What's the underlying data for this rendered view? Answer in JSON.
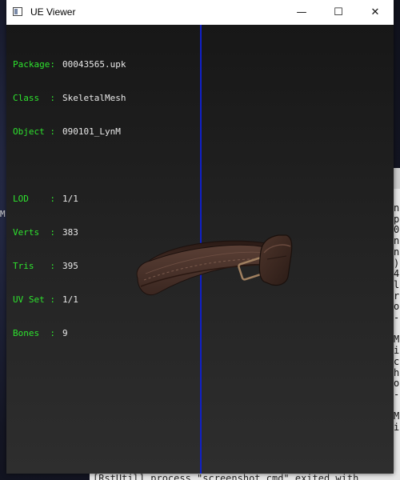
{
  "window": {
    "title": "UE Viewer",
    "minimize_glyph": "—",
    "maximize_glyph": "☐",
    "close_glyph": "✕"
  },
  "stats": {
    "package_label": "Package:",
    "package_value": "00043565.upk",
    "class_label": "Class  :",
    "class_value": "SkeletalMesh",
    "object_label": "Object :",
    "object_value": "090101_LynM",
    "lod_label": "LOD    :",
    "lod_value": "1/1",
    "verts_label": "Verts  :",
    "verts_value": "383",
    "tris_label": "Tris   :",
    "tris_value": "395",
    "uvset_label": "UV Set :",
    "uvset_value": "1/1",
    "bones_label": "Bones  :",
    "bones_value": "9"
  },
  "background": {
    "left_fragment": "M",
    "right_chars": "n\np\n0\nn\nn\n)\n4\nl\nr\no\n-\n\nM\ni\nc\nh\no\n-\n\nM\ni",
    "bottom_text": "[RstUtil] process \"screenshot.cmd\" exited with"
  },
  "colors": {
    "label_green": "#2ee32e",
    "axis_line": "#1020c8"
  }
}
